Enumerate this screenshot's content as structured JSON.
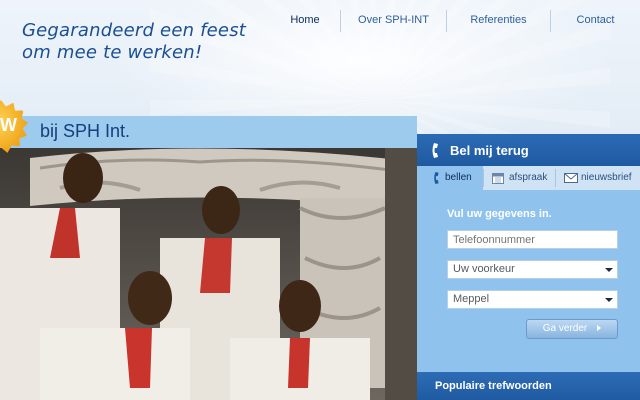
{
  "header": {
    "slogan_line1": "Gegarandeerd een feest",
    "slogan_line2": "om mee te werken!"
  },
  "nav": {
    "items": [
      {
        "label": "Home",
        "active": true
      },
      {
        "label": "Over SPH-INT",
        "active": false
      },
      {
        "label": "Referenties",
        "active": false
      },
      {
        "label": "Contact",
        "active": false
      }
    ]
  },
  "hero": {
    "title": "bij SPH Int.",
    "badge_text": "W"
  },
  "callback": {
    "title": "Bel mij terug",
    "tabs": [
      {
        "label": "bellen",
        "icon": "phone-icon",
        "active": true
      },
      {
        "label": "afspraak",
        "icon": "calendar-icon",
        "active": false
      },
      {
        "label": "nieuwsbrief",
        "icon": "envelope-icon",
        "active": false
      }
    ],
    "form_title": "Vul uw gegevens in.",
    "phone_placeholder": "Telefoonnummer",
    "preference_value": "Uw voorkeur",
    "location_value": "Meppel",
    "submit_label": "Ga verder"
  },
  "popular": {
    "title": "Populaire trefwoorden"
  },
  "colors": {
    "brand_blue": "#1f5aa1",
    "panel_blue": "#8fc2ec",
    "accent_yellow": "#f5b31f"
  }
}
